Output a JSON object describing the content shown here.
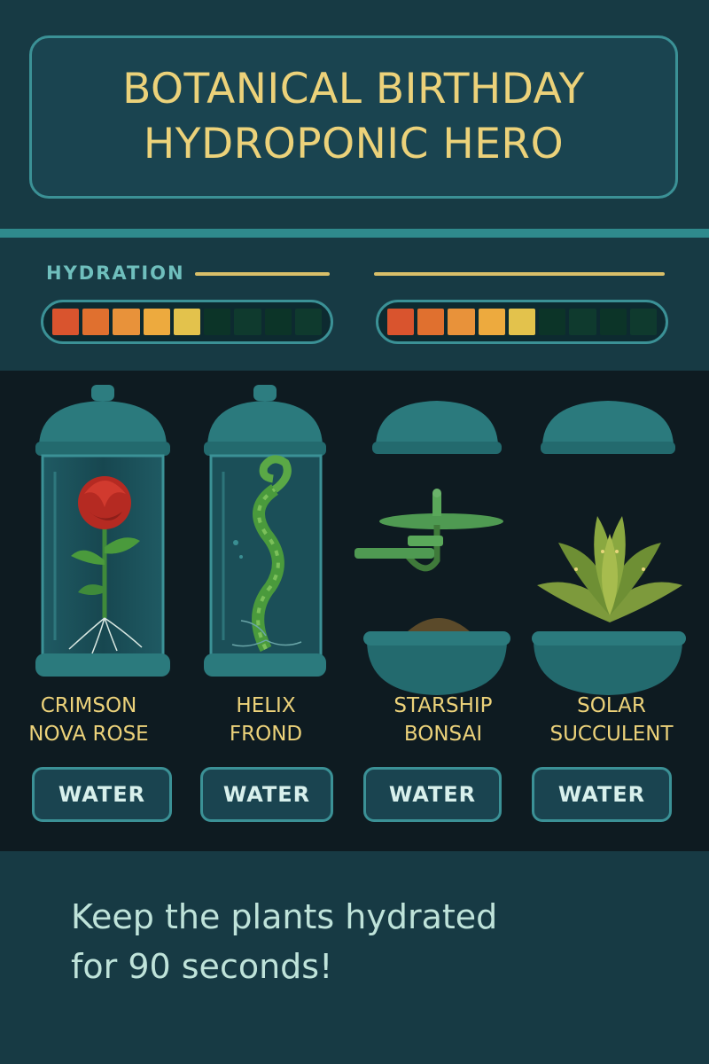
{
  "header": {
    "title_line1": "BOTANICAL BIRTHDAY",
    "title_line2": "HYDROPONIC HERO"
  },
  "hydration": {
    "label": "HYDRATION",
    "meters": [
      {
        "filled_segments": 5,
        "total_segments": 9
      },
      {
        "filled_segments": 5,
        "total_segments": 9
      }
    ],
    "colors": {
      "filled": [
        "#d9542e",
        "#e0702f",
        "#e8923a",
        "#edaa3e",
        "#e3c24c"
      ],
      "empty": "#0f3a2e",
      "empty_alt": "#0c3428"
    }
  },
  "plants": [
    {
      "name_line1": "CRIMSON",
      "name_line2": "NOVA ROSE",
      "button": "WATER",
      "icon": "rose-icon",
      "enclosure": "dome"
    },
    {
      "name_line1": "HELIX",
      "name_line2": "FROND",
      "button": "WATER",
      "icon": "helix-frond-icon",
      "enclosure": "dome"
    },
    {
      "name_line1": "STARSHIP",
      "name_line2": "BONSAI",
      "button": "WATER",
      "icon": "starship-bonsai-icon",
      "enclosure": "open-lid"
    },
    {
      "name_line1": "SOLAR",
      "name_line2": "SUCCULENT",
      "button": "WATER",
      "icon": "succulent-icon",
      "enclosure": "open-lid"
    }
  ],
  "footer": {
    "line1": "Keep the plants hydrated",
    "line2": "for 90 seconds!"
  },
  "palette": {
    "accent": "#3b9196",
    "title_text": "#ecd27a",
    "background": "#173a44",
    "plant_area": "#0e1b21"
  }
}
